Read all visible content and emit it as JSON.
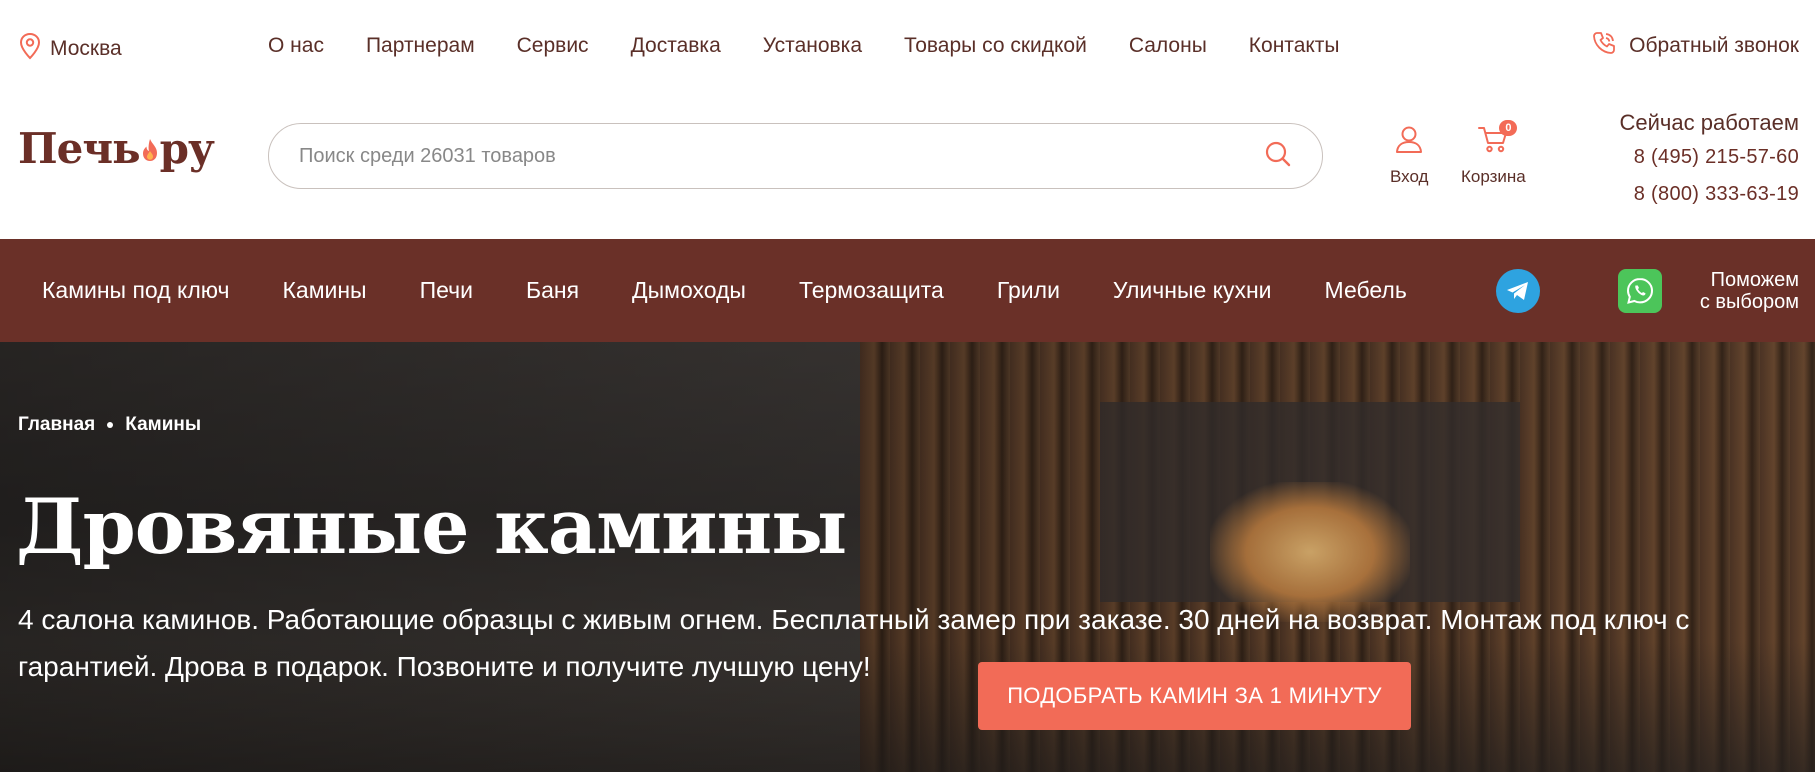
{
  "topbar": {
    "city": "Москва",
    "nav": [
      "О нас",
      "Партнерам",
      "Сервис",
      "Доставка",
      "Установка",
      "Товары со скидкой",
      "Салоны",
      "Контакты"
    ],
    "callback": "Обратный звонок"
  },
  "header": {
    "logo": {
      "part1": "Печь",
      "part2": "ру"
    },
    "search_placeholder": "Поиск среди 26031 товаров",
    "login_label": "Вход",
    "cart_label": "Корзина",
    "cart_count": "0",
    "work_status": "Сейчас работаем",
    "phone1": "8 (495) 215-57-60",
    "phone2": "8 (800) 333-63-19"
  },
  "catnav": {
    "items": [
      "Камины под ключ",
      "Камины",
      "Печи",
      "Баня",
      "Дымоходы",
      "Термозащита",
      "Грили",
      "Уличные кухни",
      "Мебель"
    ],
    "help_line1": "Поможем",
    "help_line2": "с выбором"
  },
  "hero": {
    "breadcrumb": [
      "Главная",
      "Камины"
    ],
    "title": "Дровяные камины",
    "text": "4 салона каминов. Работающие образцы с живым огнем. Бесплатный замер при заказе. 30 дней на возврат. Монтаж под ключ с гарантией. Дрова в подарок. Позвоните и получите лучшую цену!",
    "cta": "ПОДОБРАТЬ КАМИН ЗА 1 МИНУТУ"
  },
  "colors": {
    "brand_brown": "#6a3028",
    "accent_coral": "#f26b57",
    "telegram": "#2ea3e0",
    "whatsapp": "#4cc55a"
  },
  "icons": [
    "location-pin-icon",
    "phone-icon",
    "search-icon",
    "user-icon",
    "cart-icon",
    "flame-icon",
    "telegram-icon",
    "whatsapp-icon"
  ]
}
